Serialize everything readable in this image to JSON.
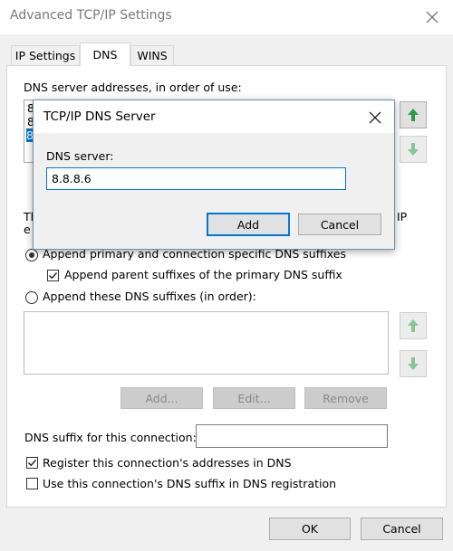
{
  "window": {
    "title": "Advanced TCP/IP Settings"
  },
  "tabs": [
    {
      "label": "IP Settings",
      "active": false
    },
    {
      "label": "DNS",
      "active": true
    },
    {
      "label": "WINS",
      "active": false
    }
  ],
  "dns": {
    "servers_label": "DNS server addresses, in order of use:",
    "server_list_fragments": [
      "8",
      "8",
      "8"
    ],
    "suffix_text_left": "Th",
    "suffix_text_left2": "e",
    "suffix_text_right": "IP",
    "append_primary_label": "Append primary and connection specific DNS suffixes",
    "append_parent_label": "Append parent suffixes of the primary DNS suffix",
    "append_these_label": "Append these DNS suffixes (in order):",
    "add_label": "Add...",
    "edit_label": "Edit...",
    "remove_label": "Remove",
    "suffix_for_connection_label": "DNS suffix for this connection:",
    "suffix_for_connection_value": "",
    "register_label": "Register this connection's addresses in DNS",
    "use_suffix_label": "Use this connection's DNS suffix in DNS registration"
  },
  "footer": {
    "ok_label": "OK",
    "cancel_label": "Cancel"
  },
  "dialog": {
    "title": "TCP/IP DNS Server",
    "field_label": "DNS server:",
    "field_value": "8.8.8.6",
    "add_label": "Add",
    "cancel_label": "Cancel"
  },
  "colors": {
    "accent": "#0078d7",
    "arrow_green": "#2d9b4a"
  }
}
